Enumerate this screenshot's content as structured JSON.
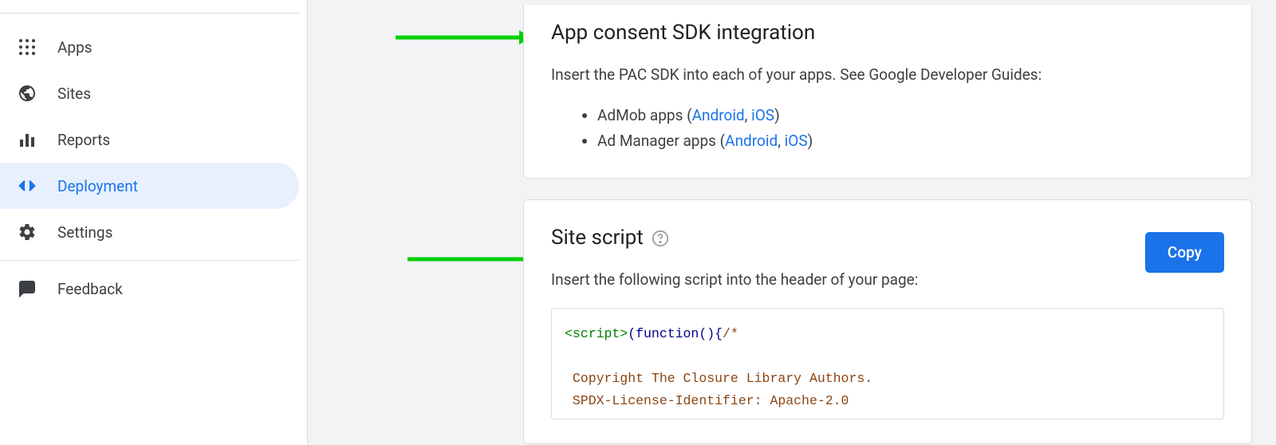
{
  "sidebar": {
    "items": [
      {
        "label": "Apps",
        "icon": "apps-icon",
        "active": false
      },
      {
        "label": "Sites",
        "icon": "globe-icon",
        "active": false
      },
      {
        "label": "Reports",
        "icon": "bar-chart-icon",
        "active": false
      },
      {
        "label": "Deployment",
        "icon": "code-icon",
        "active": true
      },
      {
        "label": "Settings",
        "icon": "gear-icon",
        "active": false
      }
    ],
    "footer_item": {
      "label": "Feedback",
      "icon": "feedback-icon"
    }
  },
  "card_sdk": {
    "title": "App consent SDK integration",
    "desc": "Insert the PAC SDK into each of your apps. See Google Developer Guides:",
    "bullets": [
      {
        "prefix": "AdMob apps (",
        "link1": "Android",
        "mid": ", ",
        "link2": "iOS",
        "suffix": ")"
      },
      {
        "prefix": "Ad Manager apps (",
        "link1": "Android",
        "mid": ", ",
        "link2": "iOS",
        "suffix": ")"
      }
    ]
  },
  "card_script": {
    "title": "Site script",
    "copy_label": "Copy",
    "desc": "Insert the following script into the header of your page:",
    "code": {
      "tag_open": "<script>",
      "fn": "(function(){",
      "comment_open": "/*",
      "comment_line1": " Copyright The Closure Library Authors.",
      "comment_line2": " SPDX-License-Identifier: Apache-2.0"
    }
  }
}
